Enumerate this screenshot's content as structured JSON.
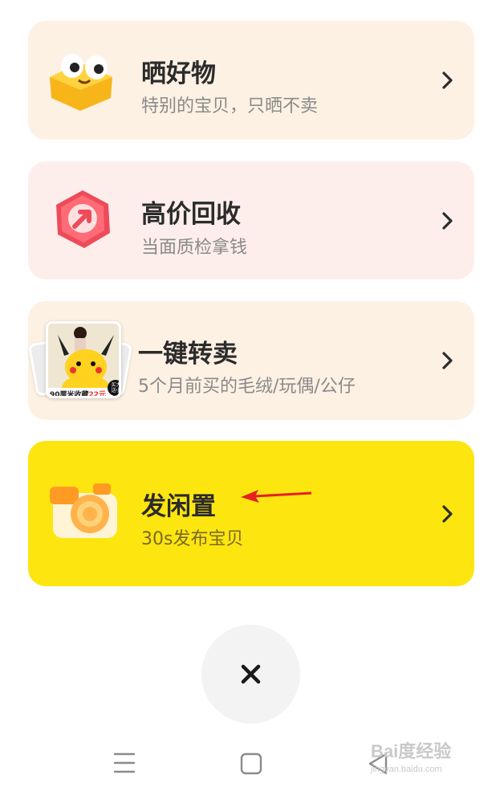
{
  "menu": {
    "items": [
      {
        "title": "晒好物",
        "subtitle": "特别的宝贝，只晒不卖",
        "icon": "happy-cube-icon"
      },
      {
        "title": "高价回收",
        "subtitle": "当面质检拿钱",
        "icon": "recycle-arrow-icon"
      },
      {
        "title": "一键转卖",
        "subtitle": "5个月前买的毛绒/玩偶/公仔",
        "icon": "product-photo-thumbnail",
        "thumb_text": "90厘米收藏",
        "thumb_price": "22元",
        "thumb_badge": "买大送小"
      },
      {
        "title": "发闲置",
        "subtitle": "30s发布宝贝",
        "icon": "camera-icon"
      }
    ]
  },
  "close": {
    "icon": "close-icon"
  },
  "navbar": {
    "menu_icon": "menu-icon",
    "home_icon": "home-icon",
    "back_icon": "back-icon"
  },
  "watermark": {
    "brand": "Bai度经验",
    "url": "jingyan.baidu.com"
  },
  "colors": {
    "card1": "#fdf1e4",
    "card2": "#fdeeec",
    "card3": "#fdf1e4",
    "card4": "#fde510",
    "arrow": "#e52020"
  }
}
